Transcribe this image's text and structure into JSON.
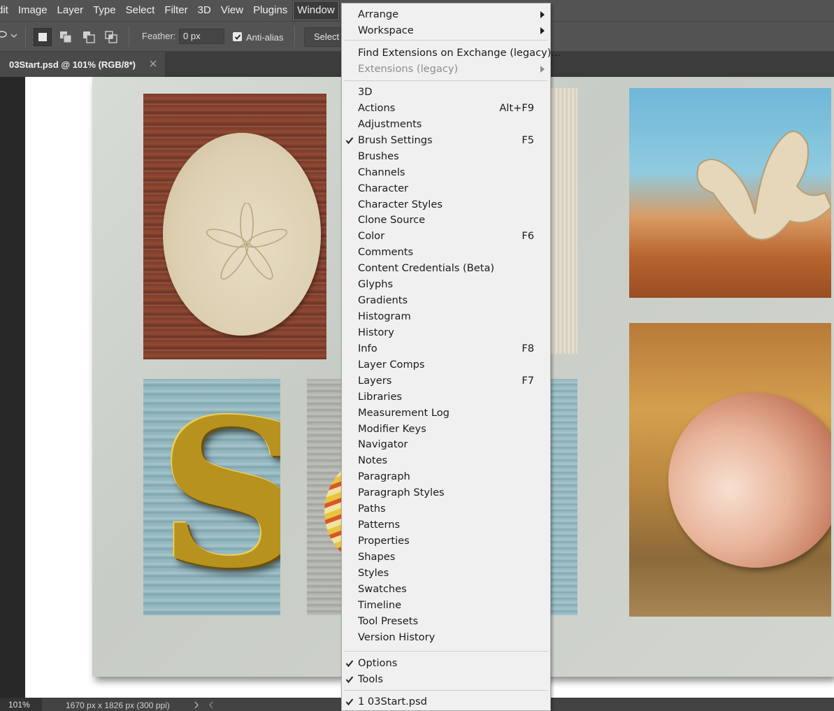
{
  "menubar": {
    "items": [
      {
        "label": "dit"
      },
      {
        "label": "Image"
      },
      {
        "label": "Layer"
      },
      {
        "label": "Type"
      },
      {
        "label": "Select"
      },
      {
        "label": "Filter"
      },
      {
        "label": "3D"
      },
      {
        "label": "View"
      },
      {
        "label": "Plugins"
      },
      {
        "label": "Window"
      }
    ],
    "active": "Window"
  },
  "options_bar": {
    "feather_label": "Feather:",
    "feather_value": "0 px",
    "anti_alias_label": "Anti-alias",
    "anti_alias_checked": true,
    "select_button_label": "Select"
  },
  "document_tab": {
    "title": "03Start.psd @ 101% (RGB/8*)"
  },
  "status_bar": {
    "zoom": "101%",
    "doc_info": "1670 px x 1826 px (300 ppi)"
  },
  "window_menu": {
    "sections": [
      [
        {
          "label": "Arrange",
          "submenu": true
        },
        {
          "label": "Workspace",
          "submenu": true
        }
      ],
      [
        {
          "label": "Find Extensions on Exchange (legacy)..."
        },
        {
          "label": "Extensions (legacy)",
          "submenu": true,
          "disabled": true
        }
      ],
      [
        {
          "label": "3D"
        },
        {
          "label": "Actions",
          "shortcut": "Alt+F9"
        },
        {
          "label": "Adjustments"
        },
        {
          "label": "Brush Settings",
          "shortcut": "F5",
          "checked": true
        },
        {
          "label": "Brushes"
        },
        {
          "label": "Channels"
        },
        {
          "label": "Character"
        },
        {
          "label": "Character Styles"
        },
        {
          "label": "Clone Source"
        },
        {
          "label": "Color",
          "shortcut": "F6"
        },
        {
          "label": "Comments"
        },
        {
          "label": "Content Credentials (Beta)"
        },
        {
          "label": "Glyphs"
        },
        {
          "label": "Gradients"
        },
        {
          "label": "Histogram"
        },
        {
          "label": "History"
        },
        {
          "label": "Info",
          "shortcut": "F8"
        },
        {
          "label": "Layer Comps"
        },
        {
          "label": "Layers",
          "shortcut": "F7"
        },
        {
          "label": "Libraries"
        },
        {
          "label": "Measurement Log"
        },
        {
          "label": "Modifier Keys"
        },
        {
          "label": "Navigator"
        },
        {
          "label": "Notes"
        },
        {
          "label": "Paragraph"
        },
        {
          "label": "Paragraph Styles"
        },
        {
          "label": "Paths"
        },
        {
          "label": "Patterns"
        },
        {
          "label": "Properties"
        },
        {
          "label": "Shapes"
        },
        {
          "label": "Styles"
        },
        {
          "label": "Swatches"
        },
        {
          "label": "Timeline"
        },
        {
          "label": "Tool Presets"
        },
        {
          "label": "Version History"
        }
      ],
      [
        {
          "label": "Options",
          "checked": true
        },
        {
          "label": "Tools",
          "checked": true
        }
      ],
      [
        {
          "label": "1 03Start.psd",
          "checked": true
        }
      ]
    ]
  }
}
